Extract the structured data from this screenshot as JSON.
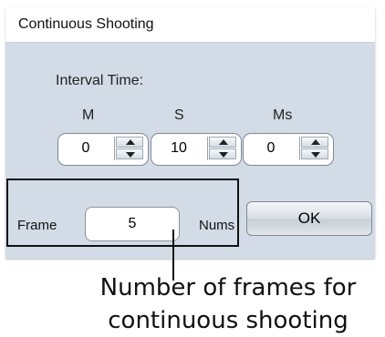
{
  "dialog": {
    "title": "Continuous Shooting",
    "interval_label": "Interval Time:",
    "units": {
      "m": "M",
      "s": "S",
      "ms": "Ms"
    },
    "spinners": {
      "m": "0",
      "s": "10",
      "ms": "0"
    },
    "frame_label": "Frame",
    "frame_value": "5",
    "nums_label": "Nums",
    "ok_label": "OK"
  },
  "annotation": {
    "caption_line1": "Number of frames for",
    "caption_line2": "continuous shooting"
  }
}
